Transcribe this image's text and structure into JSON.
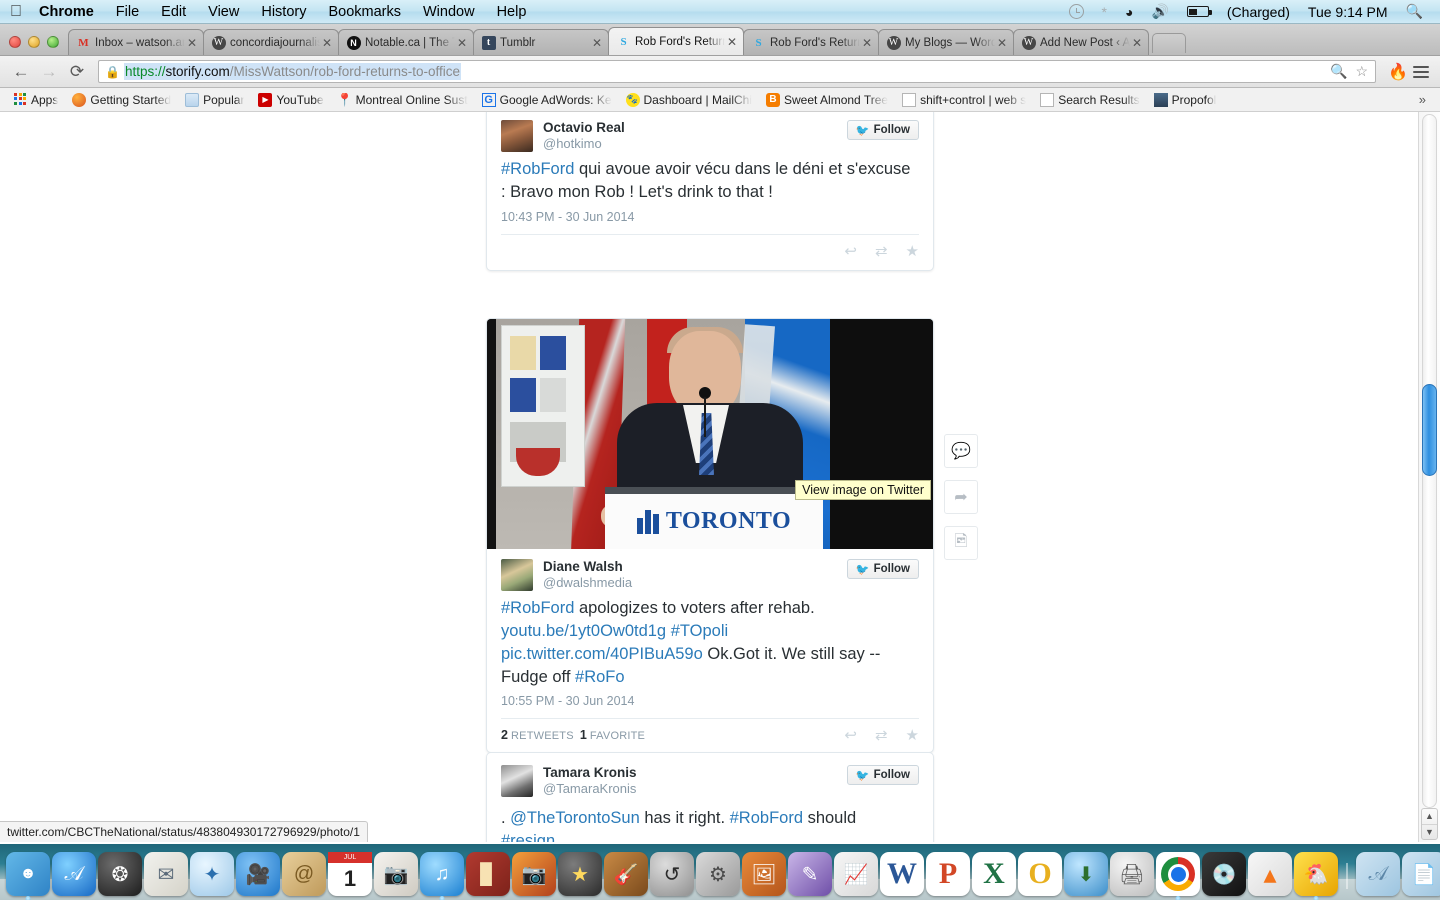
{
  "menubar": {
    "apple": "apple-logo",
    "items": [
      {
        "label": "Chrome",
        "bold": true
      },
      {
        "label": "File",
        "bold": false
      },
      {
        "label": "Edit",
        "bold": false
      },
      {
        "label": "View",
        "bold": false
      },
      {
        "label": "History",
        "bold": false
      },
      {
        "label": "Bookmarks",
        "bold": false
      },
      {
        "label": "Window",
        "bold": false
      },
      {
        "label": "Help",
        "bold": false
      }
    ],
    "status": {
      "battery_label": "(Charged)",
      "clock": "Tue 9:14 PM"
    }
  },
  "tabs": [
    {
      "title": "Inbox – watson.amie",
      "favicon": "gmail-icon",
      "active": false
    },
    {
      "title": "concordiajournalism",
      "favicon": "wordpress-icon",
      "active": false
    },
    {
      "title": "Notable.ca | The Top",
      "favicon": "notable-icon",
      "active": false
    },
    {
      "title": "Tumblr",
      "favicon": "tumblr-icon",
      "active": false
    },
    {
      "title": "Rob Ford's Return to",
      "favicon": "storify-icon",
      "active": true
    },
    {
      "title": "Rob Ford's Return to",
      "favicon": "storify-icon",
      "active": false
    },
    {
      "title": "My Blogs — WordPre",
      "favicon": "wordpress-icon",
      "active": false
    },
    {
      "title": "Add New Post ‹ Amie",
      "favicon": "wordpress-icon",
      "active": false
    }
  ],
  "toolbar": {
    "back": "←",
    "forward": "→",
    "reload": "⟳",
    "url_scheme": "https://",
    "url_host": "storify.com",
    "url_path": "/MissWattson/rob-ford-returns-to-office",
    "zoom_icon": "zoom-out-icon",
    "bookmark_icon": "star-icon",
    "extension_icon": "flame-extension-icon",
    "menu_icon": "hamburger-menu-icon"
  },
  "bookmarks": {
    "items": [
      {
        "label": "Apps",
        "icon": "apps-grid-icon"
      },
      {
        "label": "Getting Started",
        "icon": "firefox-icon"
      },
      {
        "label": "Popular",
        "icon": "folder-icon"
      },
      {
        "label": "YouTube",
        "icon": "youtube-icon"
      },
      {
        "label": "Montreal Online Sust",
        "icon": "map-pin-icon"
      },
      {
        "label": "Google AdWords: Ke",
        "icon": "google-icon"
      },
      {
        "label": "Dashboard | MailChi",
        "icon": "mailchimp-icon"
      },
      {
        "label": "Sweet Almond Tree",
        "icon": "blogger-icon"
      },
      {
        "label": "shift+control | web s",
        "icon": "page-icon"
      },
      {
        "label": "Search Results",
        "icon": "page-icon"
      },
      {
        "label": "Propofol",
        "icon": "propofol-icon"
      }
    ],
    "overflow": "»"
  },
  "page": {
    "tweets": [
      {
        "name": "Octavio Real",
        "handle": "@hotkimo",
        "follow": "Follow",
        "body_parts": [
          {
            "text": "#RobFord",
            "link": true
          },
          {
            "text": " qui avoue avoir vécu dans le déni et s'excuse : Bravo mon Rob ! Let's drink to that !",
            "link": false
          }
        ],
        "time": "10:43 PM - 30 Jun 2014",
        "stats": "",
        "actions": [
          "reply-icon",
          "retweet-icon",
          "favorite-icon"
        ]
      },
      {
        "name": "Diane Walsh",
        "handle": "@dwalshmedia",
        "follow": "Follow",
        "has_photo": true,
        "photo_alt": "Rob Ford speaking at Toronto podium",
        "photo_tooltip": "View image on Twitter",
        "podium_text": "TORONTO",
        "body_parts": [
          {
            "text": "#RobFord",
            "link": true
          },
          {
            "text": " apologizes to voters after rehab. ",
            "link": false
          },
          {
            "text": "youtu.be/1yt0Ow0td1g",
            "link": true
          },
          {
            "text": " ",
            "link": false
          },
          {
            "text": "#TOpoli",
            "link": true
          },
          {
            "text": " ",
            "link": false
          },
          {
            "text": "pic.twitter.com/40PIBuA59o",
            "link": true
          },
          {
            "text": " Ok.Got it. We still say -- Fudge off ",
            "link": false
          },
          {
            "text": "#RoFo",
            "link": true
          }
        ],
        "time": "10:55 PM - 30 Jun 2014",
        "retweet_count": "2",
        "retweet_label": "RETWEETS",
        "favorite_count": "1",
        "favorite_label": "FAVORITE",
        "actions": [
          "reply-icon",
          "retweet-icon",
          "favorite-icon"
        ]
      },
      {
        "name": "Tamara Kronis",
        "handle": "@TamaraKronis",
        "follow": "Follow",
        "body_parts": [
          {
            "text": ". ",
            "link": false
          },
          {
            "text": "@TheTorontoSun",
            "link": true
          },
          {
            "text": " has it right. ",
            "link": false
          },
          {
            "text": "#RobFord",
            "link": true
          },
          {
            "text": " should ",
            "link": false
          },
          {
            "text": "#resign",
            "link": true
          },
          {
            "text": ".",
            "link": false
          }
        ],
        "time": "",
        "stats": ""
      }
    ],
    "side_actions": [
      {
        "icon": "comment-icon",
        "name": "comment-button"
      },
      {
        "icon": "share-icon",
        "name": "share-button"
      },
      {
        "icon": "image-icon",
        "name": "image-button"
      }
    ],
    "status_url": "twitter.com/CBCTheNational/status/483804930172796929/photo/1"
  },
  "dock": {
    "items": [
      {
        "name": "finder",
        "glyph": "◯",
        "cls": "d-finder",
        "running": true
      },
      {
        "name": "app-store",
        "glyph": "A",
        "cls": "d-appstore",
        "running": false
      },
      {
        "name": "dashboard-compass",
        "glyph": "✶",
        "cls": "d-compass",
        "running": false
      },
      {
        "name": "mail",
        "glyph": "✉",
        "cls": "d-mail",
        "running": false
      },
      {
        "name": "safari",
        "glyph": "⌖",
        "cls": "d-safari",
        "running": false
      },
      {
        "name": "facetime",
        "glyph": "▶",
        "cls": "d-facetime",
        "running": false
      },
      {
        "name": "contacts",
        "glyph": "@",
        "cls": "d-contacts",
        "running": false
      },
      {
        "name": "calendar",
        "glyph": "1",
        "cls": "d-cal",
        "running": false,
        "month": "JUL"
      },
      {
        "name": "photo-booth",
        "glyph": "◉",
        "cls": "d-photo",
        "running": false
      },
      {
        "name": "itunes",
        "glyph": "♫",
        "cls": "d-itunes",
        "running": true
      },
      {
        "name": "theatre",
        "glyph": "☰",
        "cls": "d-theatre",
        "running": false
      },
      {
        "name": "iphoto",
        "glyph": "❀",
        "cls": "d-iphoto",
        "running": false
      },
      {
        "name": "imovie",
        "glyph": "★",
        "cls": "d-imovie",
        "running": false
      },
      {
        "name": "garageband",
        "glyph": "♪",
        "cls": "d-garage",
        "running": false
      },
      {
        "name": "time-machine",
        "glyph": "↺",
        "cls": "d-timem",
        "running": false
      },
      {
        "name": "system-preferences",
        "glyph": "⚙",
        "cls": "d-prefs",
        "running": false
      },
      {
        "name": "keynote",
        "glyph": "▤",
        "cls": "d-keynote",
        "running": false
      },
      {
        "name": "pages",
        "glyph": "✎",
        "cls": "d-pages",
        "running": false
      },
      {
        "name": "numbers",
        "glyph": "☰",
        "cls": "d-numbers",
        "running": false
      },
      {
        "name": "microsoft-word",
        "glyph": "W",
        "cls": "d-word",
        "running": false
      },
      {
        "name": "microsoft-powerpoint",
        "glyph": "P",
        "cls": "d-ppt",
        "running": false
      },
      {
        "name": "microsoft-excel",
        "glyph": "X",
        "cls": "d-excel",
        "running": false
      },
      {
        "name": "microsoft-outlook",
        "glyph": "O",
        "cls": "d-outlook",
        "running": false
      },
      {
        "name": "downloads-app",
        "glyph": "↓",
        "cls": "d-download",
        "running": false
      },
      {
        "name": "print-queue",
        "glyph": "⎙",
        "cls": "d-print",
        "running": false
      },
      {
        "name": "google-chrome",
        "glyph": "",
        "cls": "d-chrome",
        "running": true
      },
      {
        "name": "disk-utility",
        "glyph": "◍",
        "cls": "d-disk",
        "running": false
      },
      {
        "name": "vlc",
        "glyph": "▲",
        "cls": "d-vlc",
        "running": false
      },
      {
        "name": "rubber-duck",
        "glyph": "◔",
        "cls": "d-duck",
        "running": true
      }
    ],
    "folders": [
      {
        "name": "applications-folder",
        "glyph": "A",
        "cls": "d-folder-a"
      },
      {
        "name": "documents-folder",
        "glyph": "▧",
        "cls": "d-folder-d"
      },
      {
        "name": "stack-no-drop",
        "glyph": "⊘",
        "cls": "d-nodrop"
      },
      {
        "name": "window-stack",
        "glyph": "▣",
        "cls": "d-window"
      },
      {
        "name": "trash",
        "glyph": "⛃",
        "cls": "d-trash"
      }
    ]
  }
}
